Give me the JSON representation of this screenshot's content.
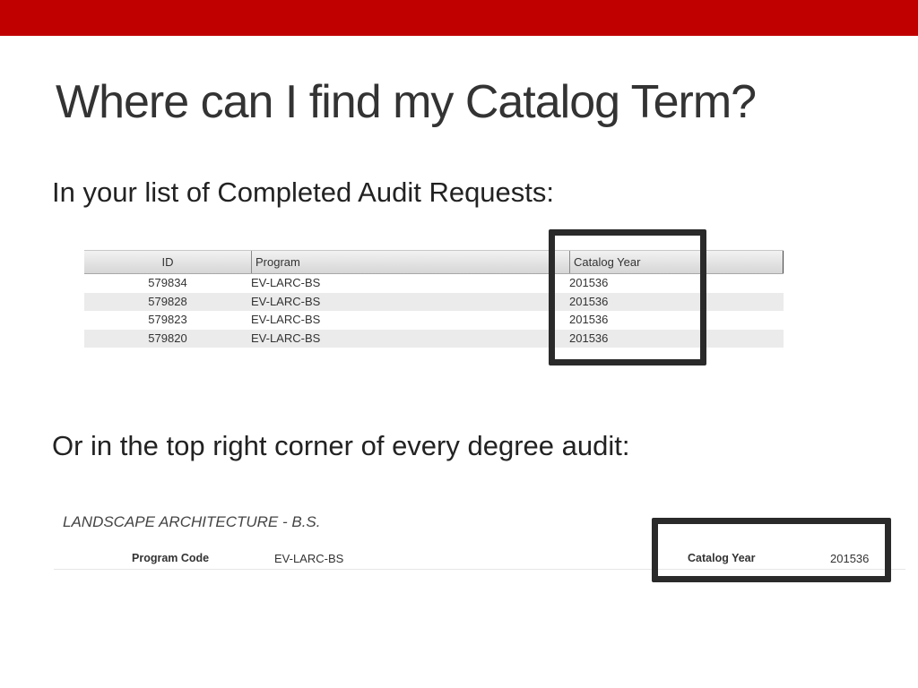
{
  "slide": {
    "title": "Where can I find my Catalog Term?",
    "caption_1": "In your list of Completed Audit Requests:",
    "caption_2": "Or in the top right corner of every degree audit:"
  },
  "colors": {
    "top_bar": "#c00000",
    "highlight_border": "#2a2a2a"
  },
  "requests_table": {
    "columns": [
      "ID",
      "Program",
      "Catalog Year"
    ],
    "rows": [
      {
        "id": "579834",
        "program": "EV-LARC-BS",
        "catalog_year": "201536"
      },
      {
        "id": "579828",
        "program": "EV-LARC-BS",
        "catalog_year": "201536"
      },
      {
        "id": "579823",
        "program": "EV-LARC-BS",
        "catalog_year": "201536"
      },
      {
        "id": "579820",
        "program": "EV-LARC-BS",
        "catalog_year": "201536"
      }
    ]
  },
  "audit_header": {
    "title": "LANDSCAPE ARCHITECTURE - B.S.",
    "program_code_label": "Program Code",
    "program_code_value": "EV-LARC-BS",
    "catalog_year_label": "Catalog Year",
    "catalog_year_value": "201536"
  }
}
